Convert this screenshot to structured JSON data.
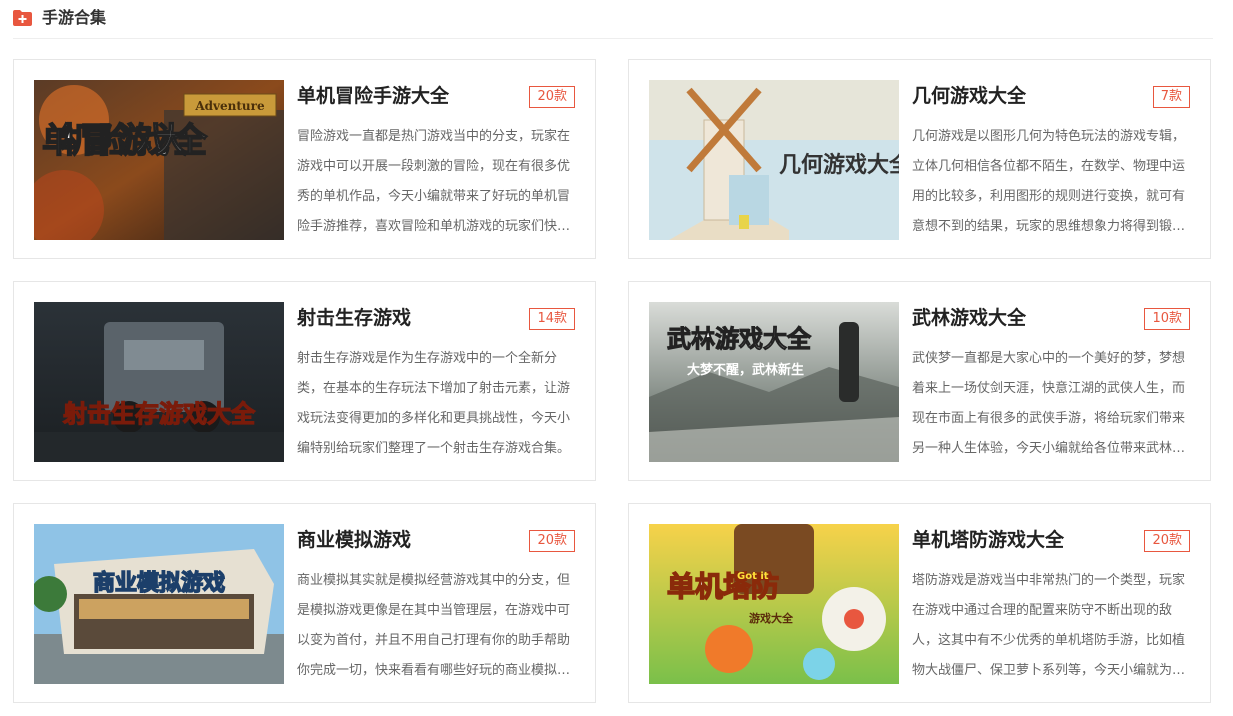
{
  "section": {
    "title": "手游合集",
    "icon": "folder-plus-icon",
    "accent_color": "#e8573f"
  },
  "cards": [
    {
      "title": "单机冒险手游大全",
      "count": "20款",
      "description": "冒险游戏一直都是热门游戏当中的分支，玩家在游戏中可以开展一段刺激的冒险，现在有很多优秀的单机作品，今天小编就带来了好玩的单机冒险手游推荐，喜欢冒险和单机游戏的玩家们快来看看吧！",
      "image_text": "单机冒险游戏大全",
      "image_badge": "Adventure"
    },
    {
      "title": "几何游戏大全",
      "count": "7款",
      "description": "几何游戏是以图形几何为特色玩法的游戏专辑，立体几何相信各位都不陌生，在数学、物理中运用的比较多，利用图形的规则进行变换，就可有意想不到的结果，玩家的思维想象力将得到锻炼。",
      "image_text": "几何游戏大全"
    },
    {
      "title": "射击生存游戏",
      "count": "14款",
      "description": "射击生存游戏是作为生存游戏中的一个全新分类，在基本的生存玩法下增加了射击元素，让游戏玩法变得更加的多样化和更具挑战性，今天小编特别给玩家们整理了一个射击生存游戏合集。",
      "image_text": "射击生存游戏大全"
    },
    {
      "title": "武林游戏大全",
      "count": "10款",
      "description": "武侠梦一直都是大家心中的一个美好的梦，梦想着来上一场仗剑天涯，快意江湖的武侠人生，而现在市面上有很多的武侠手游，将给玩家们带来另一种人生体验，今天小编就给各位带来武林游戏大全。",
      "image_text": "武林游戏大全",
      "image_subtext": "大梦不醒，武林新生"
    },
    {
      "title": "商业模拟游戏",
      "count": "20款",
      "description": " 商业模拟其实就是模拟经营游戏其中的分支，但是模拟游戏更像是在其中当管理层，在游戏中可以变为首付，并且不用自己打理有你的助手帮助你完成一切，快来看看有哪些好玩的商业模拟游戏吧！",
      "image_text": "商业模拟游戏"
    },
    {
      "title": "单机塔防游戏大全",
      "count": "20款",
      "description": "塔防游戏是游戏当中非常热门的一个类型，玩家在游戏中通过合理的配置来防守不断出现的敌人，这其中有不少优秀的单机塔防手游，比如植物大战僵尸、保卫萝卜系列等，今天小编就为大家整理了。",
      "image_text": "单机塔防",
      "image_subtext": "游戏大全",
      "image_badge": "Got it"
    }
  ]
}
